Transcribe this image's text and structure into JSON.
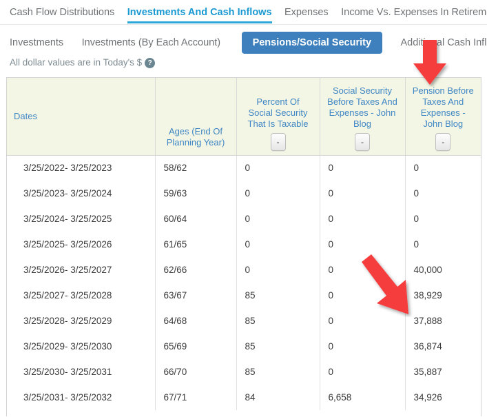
{
  "main_tabs": [
    {
      "label": "Cash Flow Distributions",
      "active": false
    },
    {
      "label": "Investments And Cash Inflows",
      "active": true
    },
    {
      "label": "Expenses",
      "active": false
    },
    {
      "label": "Income Vs. Expenses In Retirement",
      "active": false
    }
  ],
  "sub_tabs": [
    {
      "label": "Investments",
      "active": false
    },
    {
      "label": "Investments (By Each Account)",
      "active": false
    },
    {
      "label": "Pensions/Social Security",
      "active": true
    },
    {
      "label": "Additional Cash Inflow",
      "active": false
    }
  ],
  "note": {
    "text": "All dollar values are in Today's $",
    "help_glyph": "?"
  },
  "colors": {
    "active_tab": "#1b9ad2",
    "sub_tab_active_bg": "#3d80bd",
    "header_bg": "#f3f6e5",
    "header_link": "#3f86c4",
    "arrow": "#f63c3c"
  },
  "table": {
    "columns": [
      {
        "key": "dates",
        "label": "Dates",
        "has_collapse": false
      },
      {
        "key": "ages",
        "label": "Ages (End Of Planning Year)",
        "has_collapse": false
      },
      {
        "key": "pct_ss_taxable",
        "label": "Percent Of Social Security That Is Taxable",
        "has_collapse": true,
        "collapse_glyph": "-"
      },
      {
        "key": "ss_before_taxes_john_blog",
        "label": "Social Security Before Taxes And Expenses - John Blog",
        "has_collapse": true,
        "collapse_glyph": "-"
      },
      {
        "key": "pension_before_taxes_john_blog",
        "label": "Pension Before Taxes And Expenses - John Blog",
        "has_collapse": true,
        "collapse_glyph": "-"
      }
    ],
    "rows": [
      {
        "dates": "3/25/2022- 3/25/2023",
        "ages": "58/62",
        "pct_ss_taxable": "0",
        "ss_before_taxes_john_blog": "0",
        "pension_before_taxes_john_blog": "0"
      },
      {
        "dates": "3/25/2023- 3/25/2024",
        "ages": "59/63",
        "pct_ss_taxable": "0",
        "ss_before_taxes_john_blog": "0",
        "pension_before_taxes_john_blog": "0"
      },
      {
        "dates": "3/25/2024- 3/25/2025",
        "ages": "60/64",
        "pct_ss_taxable": "0",
        "ss_before_taxes_john_blog": "0",
        "pension_before_taxes_john_blog": "0"
      },
      {
        "dates": "3/25/2025- 3/25/2026",
        "ages": "61/65",
        "pct_ss_taxable": "0",
        "ss_before_taxes_john_blog": "0",
        "pension_before_taxes_john_blog": "0"
      },
      {
        "dates": "3/25/2026- 3/25/2027",
        "ages": "62/66",
        "pct_ss_taxable": "0",
        "ss_before_taxes_john_blog": "0",
        "pension_before_taxes_john_blog": "40,000"
      },
      {
        "dates": "3/25/2027- 3/25/2028",
        "ages": "63/67",
        "pct_ss_taxable": "85",
        "ss_before_taxes_john_blog": "0",
        "pension_before_taxes_john_blog": "38,929"
      },
      {
        "dates": "3/25/2028- 3/25/2029",
        "ages": "64/68",
        "pct_ss_taxable": "85",
        "ss_before_taxes_john_blog": "0",
        "pension_before_taxes_john_blog": "37,888"
      },
      {
        "dates": "3/25/2029- 3/25/2030",
        "ages": "65/69",
        "pct_ss_taxable": "85",
        "ss_before_taxes_john_blog": "0",
        "pension_before_taxes_john_blog": "36,874"
      },
      {
        "dates": "3/25/2030- 3/25/2031",
        "ages": "66/70",
        "pct_ss_taxable": "85",
        "ss_before_taxes_john_blog": "0",
        "pension_before_taxes_john_blog": "35,887"
      },
      {
        "dates": "3/25/2031- 3/25/2032",
        "ages": "67/71",
        "pct_ss_taxable": "84",
        "ss_before_taxes_john_blog": "6,658",
        "pension_before_taxes_john_blog": "34,926"
      }
    ]
  },
  "annotations": [
    {
      "name": "arrow-pointing-to-pension-column-header",
      "direction": "down"
    },
    {
      "name": "arrow-pointing-to-pension-value-cell",
      "direction": "down-right"
    }
  ]
}
